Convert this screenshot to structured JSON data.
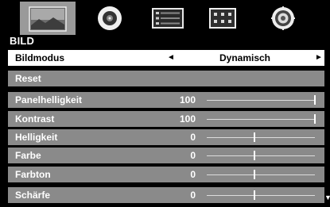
{
  "tabs": [
    {
      "icon": "picture-icon",
      "active": true
    },
    {
      "icon": "speaker-icon",
      "active": false
    },
    {
      "icon": "settings-list-icon",
      "active": false
    },
    {
      "icon": "grid-options-icon",
      "active": false
    },
    {
      "icon": "gear-icon",
      "active": false
    }
  ],
  "section_title": "BILD",
  "menu": {
    "picture_mode": {
      "label": "Bildmodus",
      "value": "Dynamisch",
      "left_arrow": "◄",
      "right_arrow": "►"
    },
    "reset": {
      "label": "Reset"
    },
    "backlight": {
      "label": "Panelhelligkeit",
      "value": "100",
      "level": 100
    },
    "contrast": {
      "label": "Kontrast",
      "value": "100",
      "level": 100
    },
    "brightness": {
      "label": "Helligkeit",
      "value": "0",
      "level": 0
    },
    "color": {
      "label": "Farbe",
      "value": "0",
      "level": 0
    },
    "tint": {
      "label": "Farbton",
      "value": "0",
      "level": 0
    },
    "sharpness": {
      "label": "Schärfe",
      "value": "0",
      "level": 0
    }
  },
  "scroll_indicator": "▼",
  "colors": {
    "row_background": "#8a8a8a",
    "selected_background": "#ffffff",
    "screen_background": "#000000"
  }
}
